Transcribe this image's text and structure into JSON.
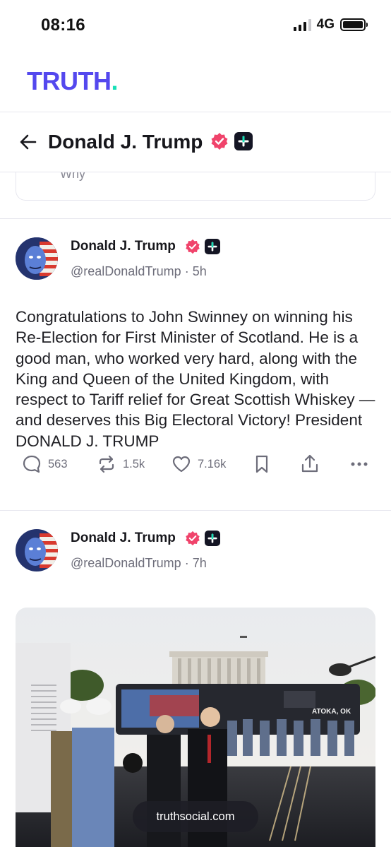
{
  "status_bar": {
    "time": "08:16",
    "network": "4G"
  },
  "brand": {
    "logo_text": "TRUTH",
    "logo_dot": ".",
    "accent": "#5448ee",
    "dot_color": "#17e0b7"
  },
  "profile_header": {
    "name": "Donald J. Trump",
    "icons": [
      "back-arrow-icon",
      "verified-icon",
      "plus-badge-icon"
    ]
  },
  "previous_post": {
    "text_fragment": "Why"
  },
  "posts": [
    {
      "author": "Donald J. Trump",
      "handle": "@realDonaldTrump",
      "time": "5h",
      "separator": "·",
      "text": "Congratulations to John Swinney on winning his Re-Election for First Minister of Scotland. He is a good man, who worked very hard, along with the King and Queen of the United Kingdom, with respect to Tariff relief for Great Scottish Whiskey — and deserves this Big Electoral Victory! President DONALD J. TRUMP",
      "actions": {
        "replies": "563",
        "retruths": "1.5k",
        "likes": "7.16k"
      }
    },
    {
      "author": "Donald J. Trump",
      "handle": "@realDonaldTrump",
      "time": "7h",
      "separator": "·",
      "media": {
        "bus_text": "ATOKA, OK",
        "link": "truthsocial.com"
      }
    }
  ],
  "colors": {
    "verified": "#f0436b",
    "plus_badge": "#141524",
    "muted": "#6d6d7a"
  }
}
